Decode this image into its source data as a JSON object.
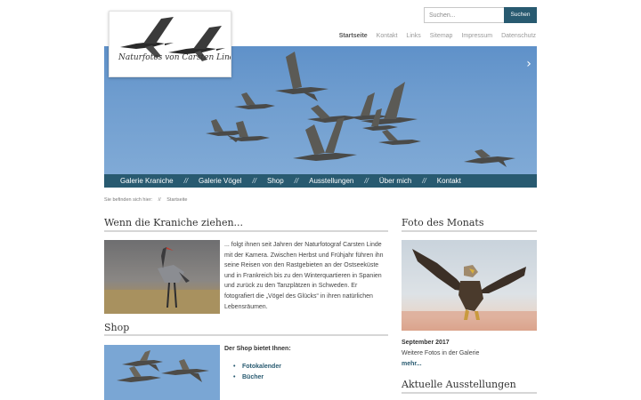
{
  "header": {
    "logo_text": "Naturfotos von Carsten Linde",
    "search": {
      "placeholder": "Suchen...",
      "button_label": "Suchen"
    },
    "top_nav": [
      "Startseite",
      "Kontakt",
      "Links",
      "Sitemap",
      "Impressum",
      "Datenschutz"
    ],
    "top_nav_active": "Startseite"
  },
  "slider": {
    "prev_icon": "‹",
    "next_icon": "›"
  },
  "main_nav": {
    "separator": "//",
    "items": [
      "Galerie Kraniche",
      "Galerie Vögel",
      "Shop",
      "Ausstellungen",
      "Über mich",
      "Kontakt"
    ]
  },
  "breadcrumb": {
    "prefix": "Sie befinden sich hier:",
    "separator": "//",
    "current": "Startseite"
  },
  "intro": {
    "title": "Wenn die Kraniche ziehen...",
    "text": "... folgt ihnen seit Jahren der Naturfotograf Carsten Linde mit der Kamera. Zwischen Herbst und Frühjahr führen ihn seine Reisen von den Rastgebieten an der Ostseeküste und in Frankreich bis zu den  Winterquartieren in Spanien und zurück zu den Tanzplätzen in Schweden. Er fotografiert die „Vögel des Glücks“ in ihren natürlichen Lebensräumen."
  },
  "shop": {
    "title": "Shop",
    "intro": "Der Shop bietet Ihnen:",
    "items": [
      "Fotokalender",
      "Bücher"
    ]
  },
  "sidebar": {
    "photo_title": "Foto des Monats",
    "date": "September 2017",
    "more_text": "Weitere Fotos in der Galerie",
    "more_link": "mehr...",
    "exhibitions_title": "Aktuelle Ausstellungen"
  },
  "colors": {
    "accent": "#285a70",
    "sky": "#6f9dcf",
    "rule": "#d6d6d6"
  }
}
